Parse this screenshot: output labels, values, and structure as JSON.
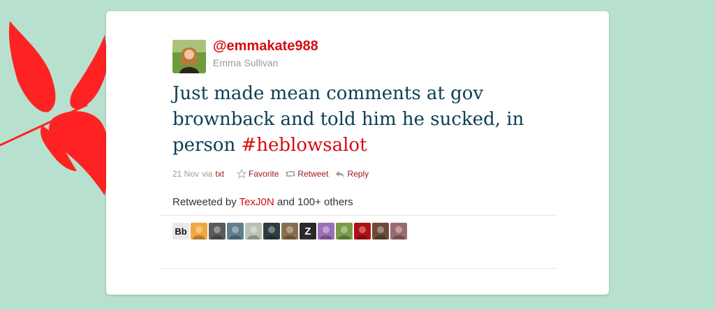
{
  "tweet": {
    "screen_name": "@emmakate988",
    "full_name": "Emma Sullivan",
    "text_main": "Just made mean comments at gov brownback and told him he sucked, in person ",
    "hashtag": "#heblowsalot",
    "date": "21 Nov",
    "via_label": "via",
    "via_source": "txt",
    "actions": {
      "favorite": "Favorite",
      "retweet": "Retweet",
      "reply": "Reply"
    }
  },
  "retweets": {
    "prefix": "Retweeted by",
    "user": "TexJ0N",
    "suffix": "and 100+ others"
  },
  "retweeter_avatars": [
    {
      "name": "bb",
      "label": "Bb",
      "color": "#e9e9e9",
      "fg": "#111111"
    },
    {
      "name": "egg",
      "label": "",
      "color": "#f2a640",
      "fg": "#ffffff"
    },
    {
      "name": "face-1",
      "label": "",
      "color": "#5a5a5a",
      "fg": "#ffffff"
    },
    {
      "name": "people-1",
      "label": "",
      "color": "#5f7f8f",
      "fg": "#ffffff"
    },
    {
      "name": "sketch",
      "label": "",
      "color": "#b9c2b5",
      "fg": "#ffffff"
    },
    {
      "name": "portrait-1",
      "label": "",
      "color": "#2f3c42",
      "fg": "#ffffff"
    },
    {
      "name": "portrait-2",
      "label": "",
      "color": "#8a6e4c",
      "fg": "#ffffff"
    },
    {
      "name": "z",
      "label": "Z",
      "color": "#2a2a2a",
      "fg": "#ffffff"
    },
    {
      "name": "anime",
      "label": "",
      "color": "#9b6fb8",
      "fg": "#ffffff"
    },
    {
      "name": "portrait-3",
      "label": "",
      "color": "#7c9b4a",
      "fg": "#ffffff"
    },
    {
      "name": "together",
      "label": "",
      "color": "#b01015",
      "fg": "#ffffff"
    },
    {
      "name": "portrait-4",
      "label": "",
      "color": "#6b4a3a",
      "fg": "#ffffff"
    },
    {
      "name": "portrait-5",
      "label": "",
      "color": "#9a6a72",
      "fg": "#ffffff"
    }
  ],
  "colors": {
    "background": "#b7e0ce",
    "accent": "#d40d12",
    "tweet_text": "#0c3e53",
    "leaf": "#ff2222"
  }
}
